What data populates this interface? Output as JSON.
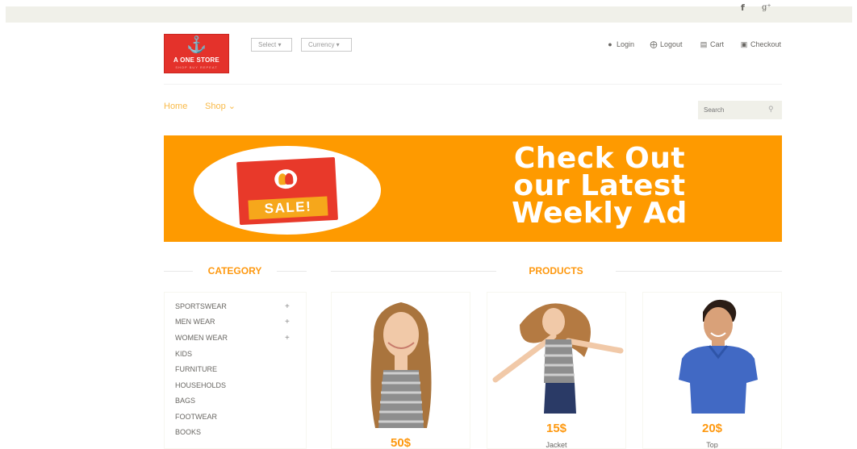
{
  "topbar": {
    "social": [
      {
        "icon": "facebook-icon",
        "glyph": "f"
      },
      {
        "icon": "google-plus-icon",
        "glyph": "g⁺"
      }
    ]
  },
  "header": {
    "logo": {
      "name": "A ONE STORE",
      "tagline": "SHOP BUY REPEAT"
    },
    "select_label": "Select ▾",
    "currency_label": "Currency ▾",
    "account": {
      "login": "Login",
      "logout": "Logout",
      "cart": "Cart",
      "checkout": "Checkout"
    }
  },
  "nav": {
    "home": "Home",
    "shop": "Shop ⌄",
    "search_placeholder": "Search"
  },
  "banner": {
    "sale_label": "SALE!",
    "headline_line1": "Check Out",
    "headline_line2": "our Latest",
    "headline_line3": "Weekly Ad"
  },
  "sections": {
    "category": "CATEGORY",
    "products": "PRODUCTS"
  },
  "categories": [
    {
      "label": "SPORTSWEAR",
      "expandable": true
    },
    {
      "label": "MEN WEAR",
      "expandable": true
    },
    {
      "label": "WOMEN WEAR",
      "expandable": true
    },
    {
      "label": "KIDS",
      "expandable": false
    },
    {
      "label": "FURNITURE",
      "expandable": false
    },
    {
      "label": "HOUSEHOLDS",
      "expandable": false
    },
    {
      "label": "BAGS",
      "expandable": false
    },
    {
      "label": "FOOTWEAR",
      "expandable": false
    },
    {
      "label": "BOOKS",
      "expandable": false
    }
  ],
  "products": [
    {
      "price": "50$",
      "name": ""
    },
    {
      "price": "15$",
      "name": "Jacket"
    },
    {
      "price": "20$",
      "name": "Top"
    }
  ],
  "colors": {
    "accent": "#fe980f",
    "brand_red": "#e4322b",
    "banner_orange": "#fe9a00",
    "topbar_bg": "#f0f0e9"
  }
}
